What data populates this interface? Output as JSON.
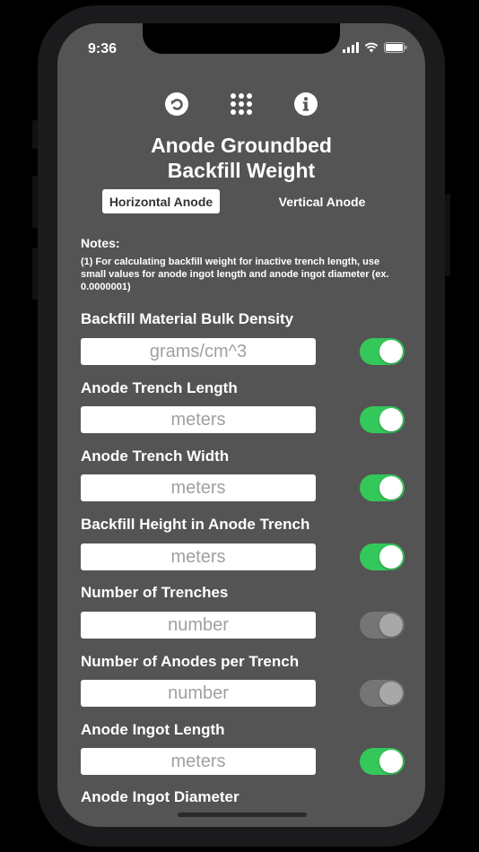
{
  "status": {
    "time": "9:36"
  },
  "title_line1": "Anode Groundbed",
  "title_line2": "Backfill Weight",
  "segments": [
    {
      "label": "Horizontal Anode",
      "selected": true
    },
    {
      "label": "Vertical Anode",
      "selected": false
    }
  ],
  "notes": {
    "title": "Notes:",
    "body": "(1) For calculating backfill weight for inactive trench length, use small values for anode ingot length and anode ingot diameter (ex. 0.0000001)"
  },
  "fields": [
    {
      "label": "Backfill Material Bulk Density",
      "placeholder": "grams/cm^3",
      "value": "",
      "toggle": "on"
    },
    {
      "label": "Anode Trench Length",
      "placeholder": "meters",
      "value": "",
      "toggle": "on"
    },
    {
      "label": "Anode Trench Width",
      "placeholder": "meters",
      "value": "",
      "toggle": "on"
    },
    {
      "label": "Backfill Height in Anode Trench",
      "placeholder": "meters",
      "value": "",
      "toggle": "on"
    },
    {
      "label": "Number of Trenches",
      "placeholder": "number",
      "value": "",
      "toggle": "off"
    },
    {
      "label": "Number of Anodes per Trench",
      "placeholder": "number",
      "value": "",
      "toggle": "off"
    },
    {
      "label": "Anode Ingot Length",
      "placeholder": "meters",
      "value": "",
      "toggle": "on"
    }
  ],
  "partial_field_label": "Anode Ingot Diameter",
  "icons": {
    "undo": "undo-icon",
    "grid": "grid-menu-icon",
    "info": "info-icon",
    "signal": "signal-icon",
    "wifi": "wifi-icon",
    "battery": "battery-icon"
  },
  "colors": {
    "background": "#545454",
    "toggle_on": "#34c759",
    "toggle_off": "#757575",
    "text": "#ffffff"
  }
}
